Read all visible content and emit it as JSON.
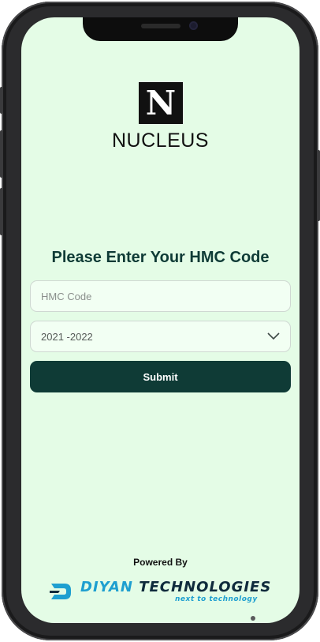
{
  "brand": {
    "logo_letter": "N",
    "name": "NUCLEUS"
  },
  "form": {
    "heading": "Please Enter Your HMC Code",
    "hmc_placeholder": "HMC Code",
    "year_selected": "2021 -2022",
    "submit_label": "Submit"
  },
  "footer": {
    "powered_by": "Powered By",
    "company_name_part1": "DIYAN",
    "company_name_part2": "TECHNOLOGIES",
    "company_tagline": "next to technology"
  },
  "colors": {
    "screen_background": "#e4fce6",
    "primary": "#0f3b36",
    "company_blue": "#1e9fd0",
    "company_dark": "#0f2a3c"
  },
  "icons": {
    "dropdown": "chevron-down-icon",
    "company": "diyan-logo-icon"
  }
}
